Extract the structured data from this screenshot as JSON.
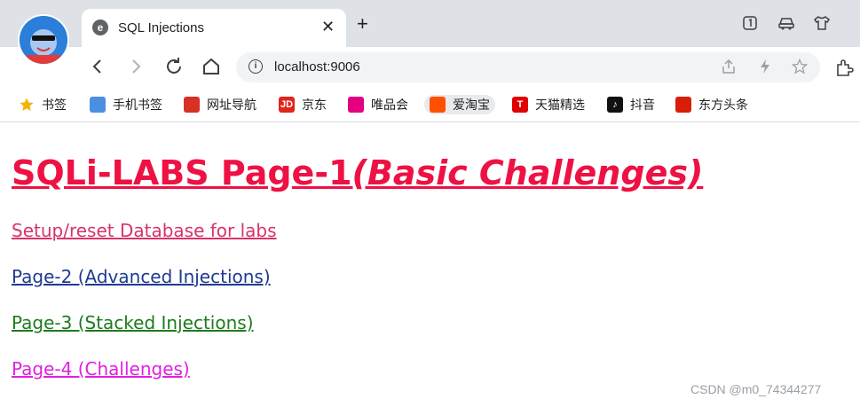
{
  "browser": {
    "tab": {
      "title": "SQL Injections",
      "close_glyph": "✕",
      "favicon": "e"
    },
    "new_tab_glyph": "+",
    "address_bar": {
      "url": "localhost:9006"
    },
    "bookmarks": [
      {
        "label": "书签",
        "icon": "star-icon",
        "color": "#f4b400"
      },
      {
        "label": "手机书签",
        "icon": "mobile-bookmark-icon",
        "color": "#4a90e2"
      },
      {
        "label": "网址导航",
        "icon": "navigation-icon",
        "color": "#d93025"
      },
      {
        "label": "京东",
        "icon": "jd-icon",
        "color": "#e1251b"
      },
      {
        "label": "唯品会",
        "icon": "vip-icon",
        "color": "#e4007f"
      },
      {
        "label": "爱淘宝",
        "icon": "taobao-icon",
        "color": "#ff5000"
      },
      {
        "label": "天猫精选",
        "icon": "tmall-icon",
        "color": "#e00000"
      },
      {
        "label": "抖音",
        "icon": "douyin-icon",
        "color": "#111111"
      },
      {
        "label": "东方头条",
        "icon": "dftt-icon",
        "color": "#d81e06"
      }
    ]
  },
  "page": {
    "title_main": "SQLi-LABS Page-1",
    "title_sub": "(Basic Challenges)",
    "title_color": "#ee1144",
    "links": [
      {
        "label": "Setup/reset Database for labs",
        "color": "#d6336c"
      },
      {
        "label": "Page-2 (Advanced Injections)",
        "color": "#1f3b8f"
      },
      {
        "label": "Page-3 (Stacked Injections)",
        "color": "#1e7b1e"
      },
      {
        "label": "Page-4 (Challenges)",
        "color": "#e020e0"
      }
    ]
  },
  "watermark": "CSDN @m0_74344277"
}
